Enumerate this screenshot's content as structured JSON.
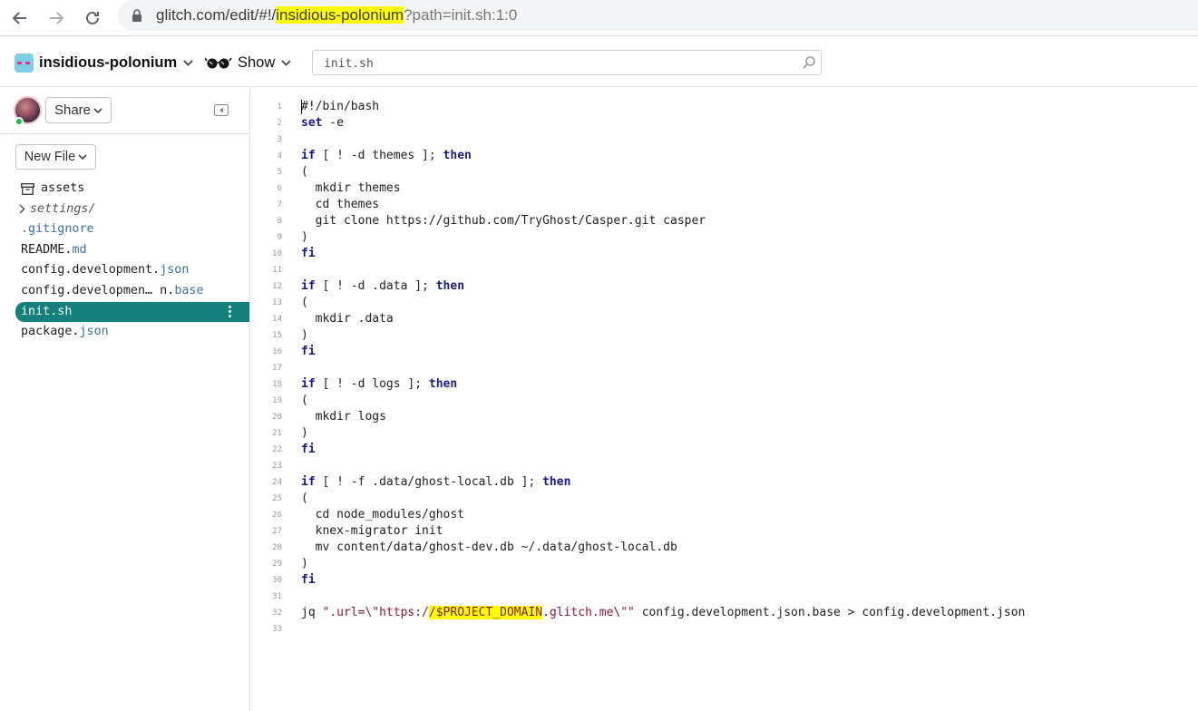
{
  "browser": {
    "url_prefix": "glitch.com/edit/#!/",
    "url_project": "insidious-polonium",
    "url_suffix": "?path=init.sh:1:0"
  },
  "header": {
    "project_name": "insidious-polonium",
    "show_label": "Show",
    "search_value": "init.sh"
  },
  "sidebar": {
    "share_label": "Share",
    "new_file_label": "New File",
    "files": [
      {
        "name": "assets",
        "ext": ""
      },
      {
        "name": "settings/",
        "ext": ""
      },
      {
        "name": ".gitignore",
        "ext": ""
      },
      {
        "name": "README.",
        "ext": "md"
      },
      {
        "name": "config.development.",
        "ext": "json"
      },
      {
        "name": "config.developmen… n.",
        "ext": "base"
      },
      {
        "name": "init.sh",
        "ext": ""
      },
      {
        "name": "package.",
        "ext": "json"
      }
    ]
  },
  "editor": {
    "line_numbers": [
      "1",
      "2",
      "3",
      "4",
      "5",
      "6",
      "7",
      "8",
      "9",
      "10",
      "11",
      "12",
      "13",
      "14",
      "15",
      "16",
      "17",
      "18",
      "19",
      "20",
      "21",
      "22",
      "23",
      "24",
      "25",
      "26",
      "27",
      "28",
      "29",
      "30",
      "31",
      "32",
      "33"
    ],
    "tokens": {
      "shebang": "#!/bin/bash",
      "kw_set": "set",
      "arg_e": " -e",
      "kw_if": "if",
      "kw_then": "then",
      "kw_fi": "fi",
      "cond4": " [ ! -d themes ]; ",
      "open_paren": "(",
      "close_paren": ")",
      "l6": "  mkdir themes",
      "l7": "  cd themes",
      "l8": "  git clone https://github.com/TryGhost/Casper.git casper",
      "cond12": " [ ! -d .data ]; ",
      "l14": "  mkdir .data",
      "cond18": " [ ! -d logs ]; ",
      "l20": "  mkdir logs",
      "cond24": " [ ! -f .data/ghost-local.db ]; ",
      "l26": "  cd node_modules/ghost",
      "l27": "  knex-migrator init",
      "l28": "  mv content/data/ghost-dev.db ~/.data/ghost-local.db",
      "l32_cmd": "jq ",
      "l32_str1": "\".url=\\\"https:/",
      "l32_var": "/$PROJECT_DOMAIN",
      "l32_str2": ".glitch.me\\\"\"",
      "l32_rest": " config.development.json.base > config.development.json"
    }
  },
  "colors": {
    "active_file_bg": "#13807e",
    "keyword": "#1b1b8c",
    "string": "#8b1a2e",
    "highlight": "#ffff00"
  }
}
